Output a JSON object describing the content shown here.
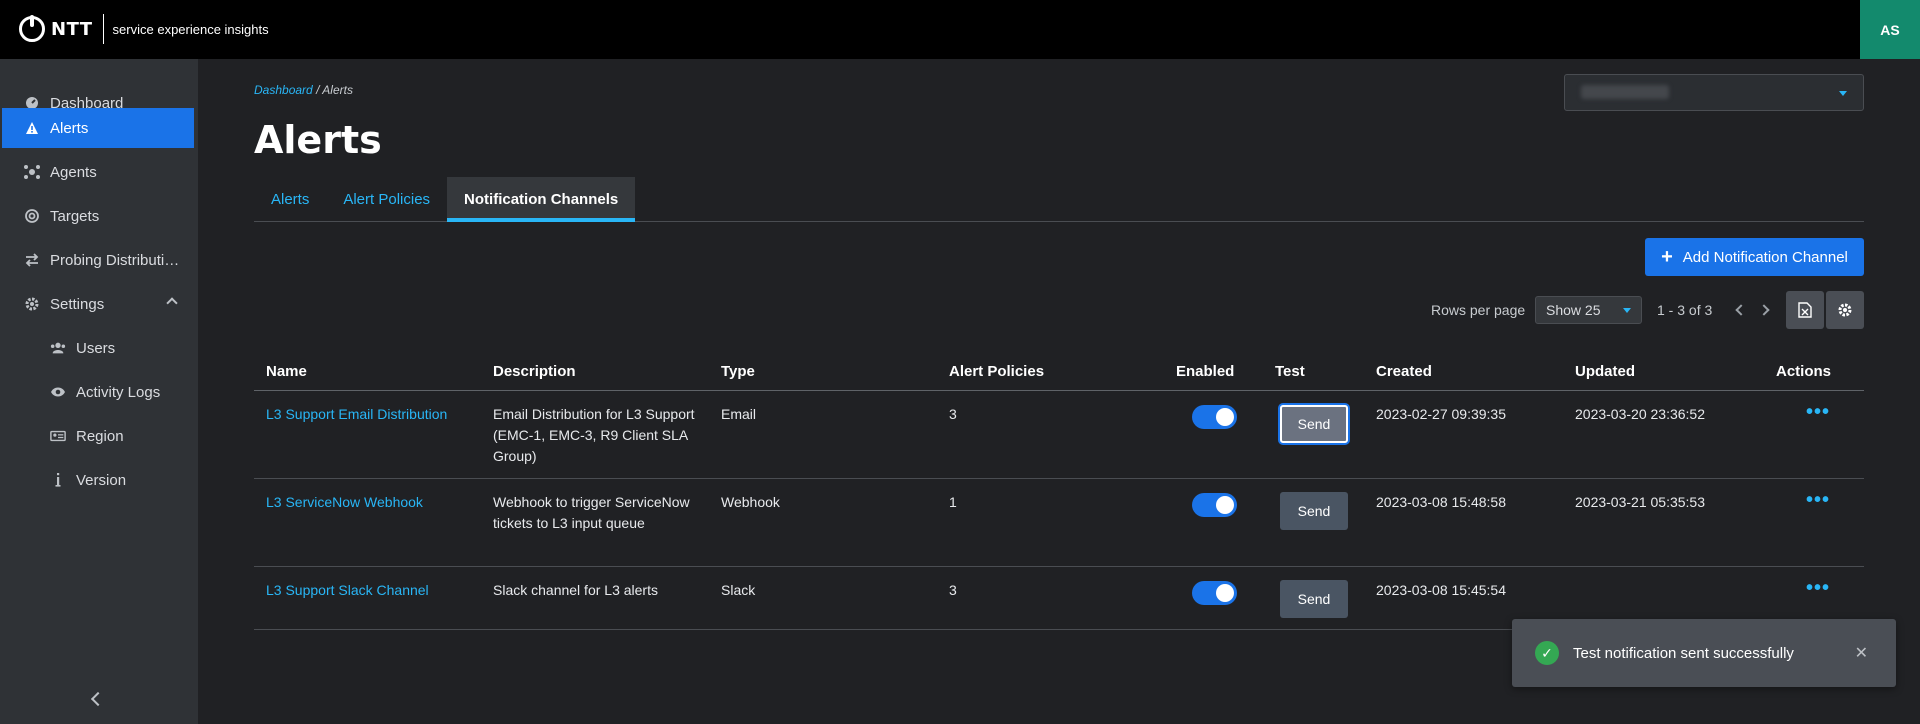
{
  "header": {
    "logo_text": "NTT",
    "logo_subtitle": "service experience insights",
    "avatar_initials": "AS"
  },
  "sidebar": {
    "items": [
      {
        "label": "Dashboard",
        "icon": "dashboard-icon"
      },
      {
        "label": "Alerts",
        "icon": "warning-icon"
      },
      {
        "label": "Agents",
        "icon": "agents-icon"
      },
      {
        "label": "Targets",
        "icon": "target-icon"
      },
      {
        "label": "Probing Distributi…",
        "icon": "swap-icon"
      },
      {
        "label": "Settings",
        "icon": "gear-icon"
      }
    ],
    "settings_sub": [
      {
        "label": "Users",
        "icon": "users-icon"
      },
      {
        "label": "Activity Logs",
        "icon": "eye-icon"
      },
      {
        "label": "Region",
        "icon": "id-card-icon"
      },
      {
        "label": "Version",
        "icon": "info-icon"
      }
    ]
  },
  "breadcrumb": {
    "parent": "Dashboard",
    "separator": "/",
    "current": "Alerts"
  },
  "page_title": "Alerts",
  "tabs": [
    {
      "label": "Alerts"
    },
    {
      "label": "Alert Policies"
    },
    {
      "label": "Notification Channels",
      "active": true
    }
  ],
  "toolbar": {
    "add_label": "Add Notification Channel",
    "rows_per_page_label": "Rows per page",
    "rows_select_value": "Show 25",
    "range": "1 - 3 of 3"
  },
  "table": {
    "columns": [
      "Name",
      "Description",
      "Type",
      "Alert Policies",
      "Enabled",
      "Test",
      "Created",
      "Updated",
      "Actions"
    ],
    "rows": [
      {
        "name": "L3 Support Email Distribution",
        "description": "Email Distribution for L3 Support (EMC-1, EMC-3, R9 Client SLA Group)",
        "type": "Email",
        "alert_policies": "3",
        "enabled": true,
        "test_label": "Send",
        "created": "2023-02-27 09:39:35",
        "updated": "2023-03-20 23:36:52"
      },
      {
        "name": "L3 ServiceNow Webhook",
        "description": "Webhook to trigger ServiceNow tickets to L3 input queue",
        "type": "Webhook",
        "alert_policies": "1",
        "enabled": true,
        "test_label": "Send",
        "created": "2023-03-08 15:48:58",
        "updated": "2023-03-21 05:35:53"
      },
      {
        "name": "L3 Support Slack Channel",
        "description": "Slack channel for L3 alerts",
        "type": "Slack",
        "alert_policies": "3",
        "enabled": true,
        "test_label": "Send",
        "created": "2023-03-08 15:45:54",
        "updated": ""
      }
    ]
  },
  "toast": {
    "message": "Test notification sent successfully"
  },
  "colors": {
    "accent": "#1a73e8",
    "link": "#29b6f6",
    "avatar": "#138a6d",
    "success": "#34a853"
  }
}
